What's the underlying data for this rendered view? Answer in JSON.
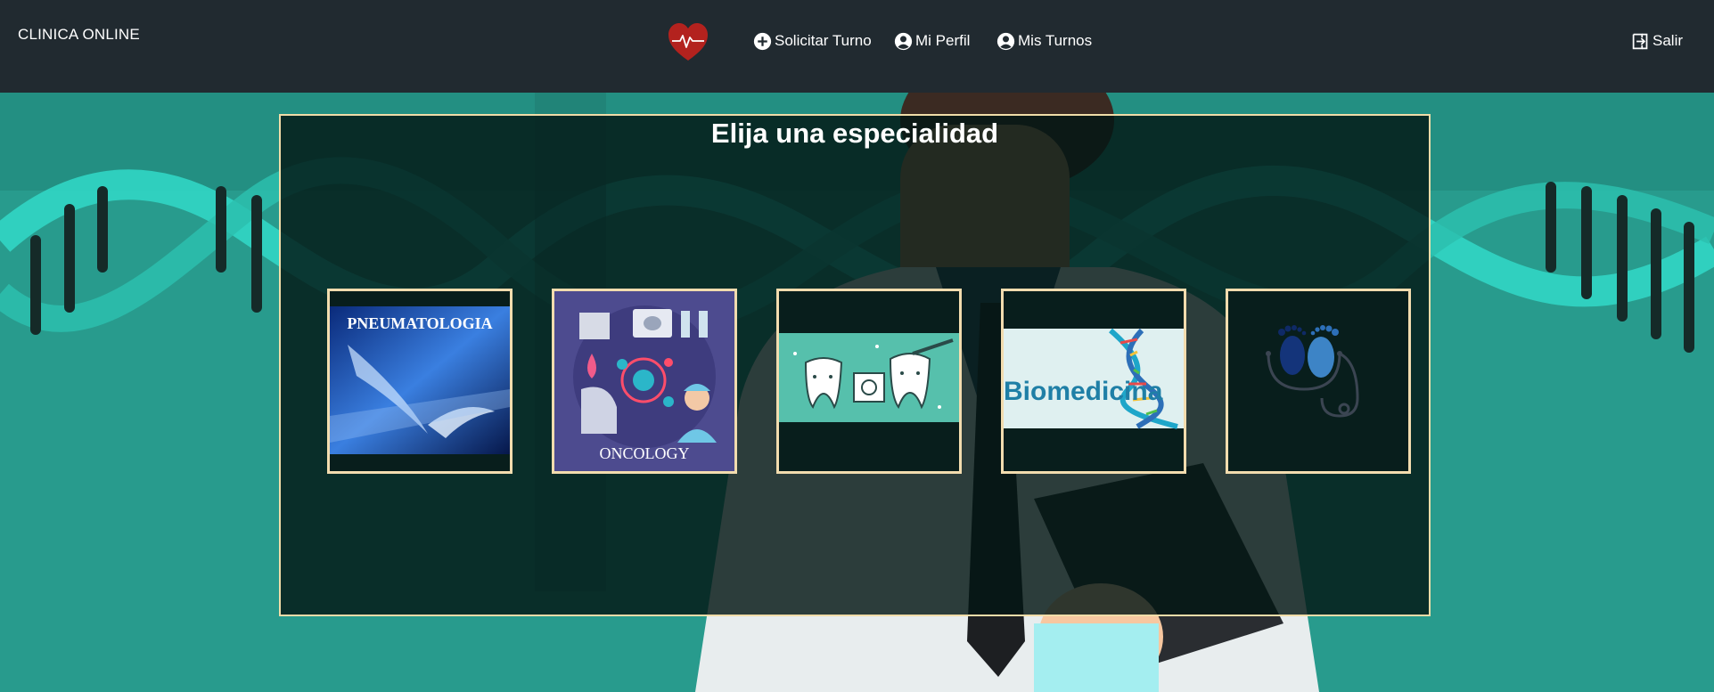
{
  "navbar": {
    "brand": "CLINICA ONLINE",
    "logo_icon": "heart-pulse-icon",
    "items": [
      {
        "label": "Solicitar Turno",
        "icon": "plus-circle-icon"
      },
      {
        "label": "Mi Perfil",
        "icon": "user-circle-icon"
      },
      {
        "label": "Mis Turnos",
        "icon": "user-circle-icon"
      },
      {
        "label": "Salir",
        "icon": "logout-icon"
      }
    ]
  },
  "main": {
    "title": "Elija una especialidad",
    "specialties": [
      {
        "image_text": "PNEUMATOLOGIA"
      },
      {
        "image_text": "ONCOLOGY"
      },
      {
        "image_text": ""
      },
      {
        "image_text": "Biomedicina"
      },
      {
        "image_text": ""
      }
    ]
  },
  "colors": {
    "navbar": "#212a30",
    "background": "#289b8d",
    "panel_border": "#f0dca8",
    "card_border": "#f2dcae",
    "logo": "#b3221e"
  }
}
